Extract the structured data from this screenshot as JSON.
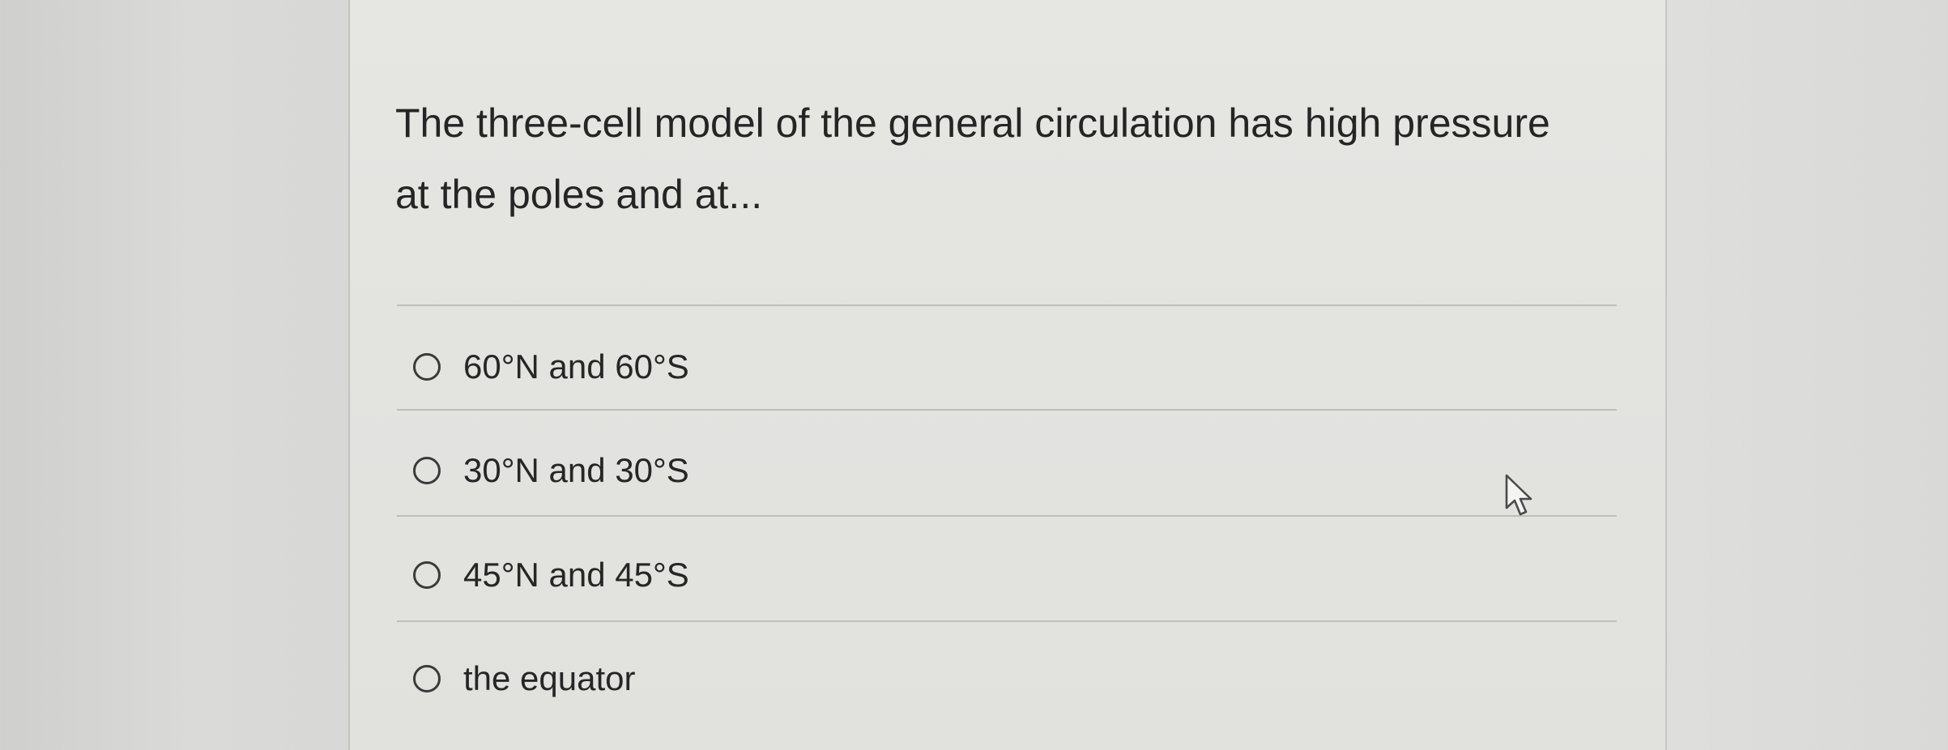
{
  "question": {
    "line1": "The three-cell model of the general circulation has high pressure",
    "line2": "at the poles and at..."
  },
  "options": [
    {
      "label": "60°N and 60°S",
      "selected": false
    },
    {
      "label": "30°N and 30°S",
      "selected": false
    },
    {
      "label": "45°N and 45°S",
      "selected": false
    },
    {
      "label": "the equator",
      "selected": false
    }
  ],
  "cursor": {
    "icon": "arrow-pointer-icon"
  }
}
